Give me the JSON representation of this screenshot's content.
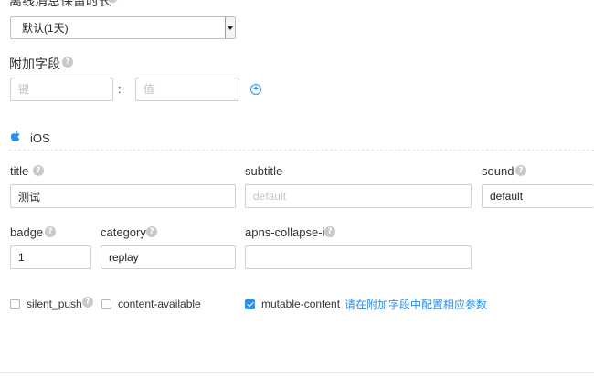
{
  "offline_retention": {
    "label": "离线消息保留时长",
    "selected": "默认(1天)"
  },
  "extra_fields": {
    "label": "附加字段",
    "key_placeholder": "键",
    "separator": ":",
    "value_placeholder": "值"
  },
  "ios": {
    "title": "iOS",
    "fields": {
      "title": {
        "label": "title",
        "value": "测试"
      },
      "subtitle": {
        "label": "subtitle",
        "placeholder": "default"
      },
      "sound": {
        "label": "sound",
        "value": "default"
      },
      "badge": {
        "label": "badge",
        "value": "1"
      },
      "category": {
        "label": "category",
        "value": "replay"
      },
      "apns_collapse_id": {
        "label": "apns-collapse-id",
        "value": ""
      }
    },
    "options": {
      "silent_push": {
        "label": "silent_push",
        "checked": false
      },
      "content_available": {
        "label": "content-available",
        "checked": false
      },
      "mutable_content": {
        "label": "mutable-content",
        "checked": true
      }
    },
    "hint_link": "请在附加字段中配置相应参数"
  },
  "help_glyph": "?",
  "icons": {
    "add": "plus-circle-icon",
    "platform": "apple-icon",
    "help": "question-circle-icon"
  },
  "colors": {
    "accent": "#2e8de6",
    "help_badge": "#c9c9c9",
    "border": "#cfcfcf"
  }
}
